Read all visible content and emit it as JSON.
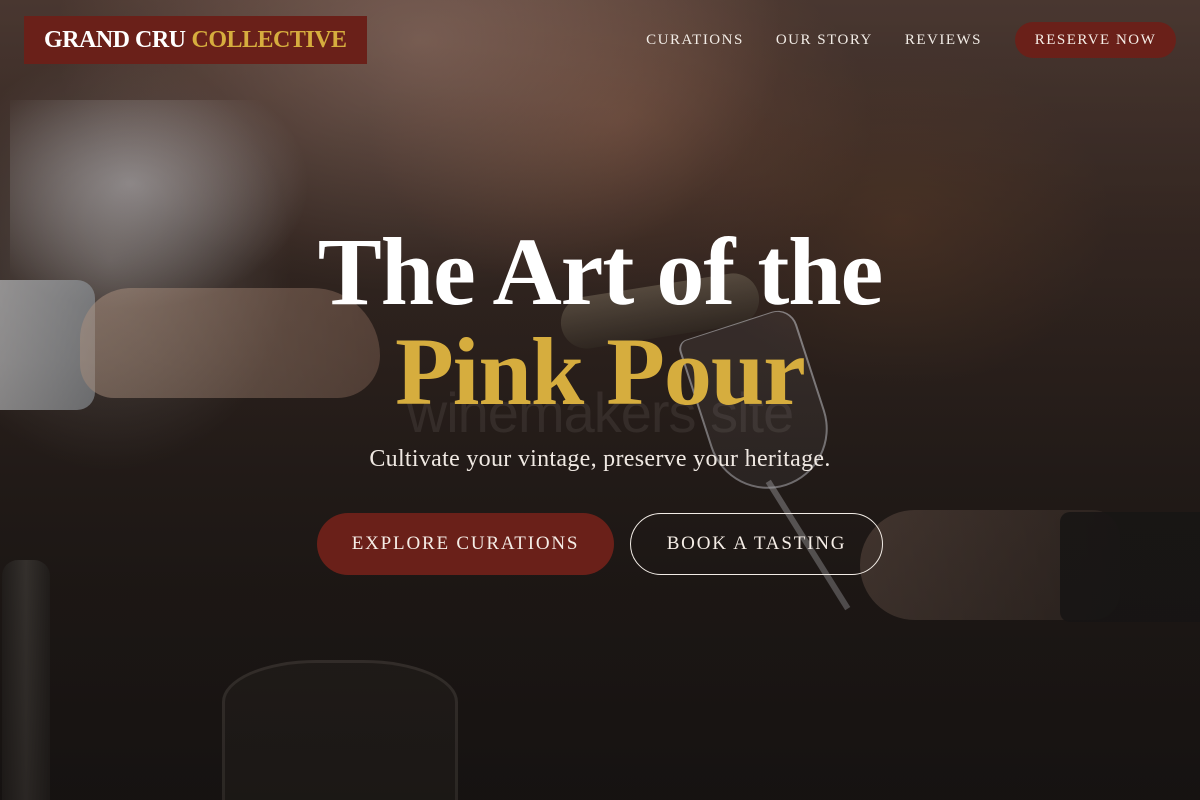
{
  "brand": {
    "name_main": "GRAND CRU",
    "name_accent": "COLLECTIVE"
  },
  "nav": {
    "links": [
      "CURATIONS",
      "OUR STORY",
      "REVIEWS"
    ],
    "reserve_label": "RESERVE NOW"
  },
  "hero": {
    "title_line_1": "The Art of the",
    "title_line_2": "Pink Pour",
    "watermark": "winemakers site",
    "tagline": "Cultivate your vintage, preserve your heritage.",
    "primary_cta": "EXPLORE CURATIONS",
    "secondary_cta": "BOOK A TASTING"
  },
  "colors": {
    "brand_red": "#6a2019",
    "gold_accent": "#d6ad3e",
    "text_light": "#f5ede6"
  }
}
